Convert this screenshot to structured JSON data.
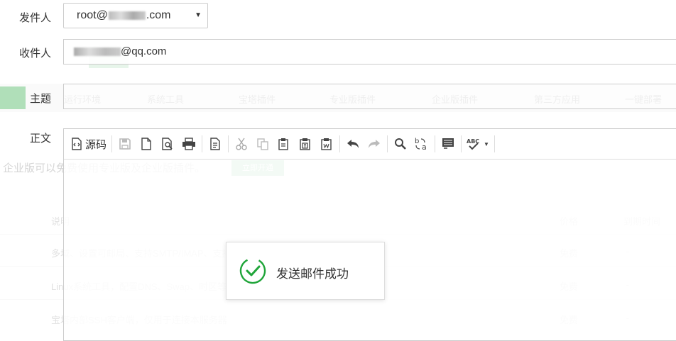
{
  "form": {
    "sender_label": "发件人",
    "sender_prefix": "root@",
    "sender_suffix": ".com",
    "recipient_label": "收件人",
    "recipient_suffix": "@qq.com",
    "subject_label": "主题",
    "body_label": "正文"
  },
  "toolbar": {
    "source_label": "源码",
    "items": [
      "source-icon",
      "save-icon",
      "new-page-icon",
      "preview-icon",
      "print-icon",
      "templates-icon",
      "cut-icon",
      "copy-icon",
      "paste-icon",
      "paste-text-icon",
      "paste-word-icon",
      "undo-icon",
      "redo-icon",
      "find-icon",
      "replace-icon",
      "select-all-icon",
      "spellcheck-icon"
    ]
  },
  "toast": {
    "message": "发送邮件成功",
    "icon": "success-check-icon",
    "color": "#20a53a"
  },
  "background": {
    "tabs": [
      "运行环境",
      "系统工具",
      "宝塔插件",
      "专业版插件",
      "企业版插件",
      "第三方应用",
      "一键部署"
    ],
    "notice": "企业版可以免费使用专业版及企业版插件。",
    "notice_button": "立即开通",
    "col_desc": "说明",
    "col_price": "价格",
    "col_expire": "到期时间",
    "rows": [
      {
        "desc": "多域、设置可邮局、支持SMTP/IMAP、支持发送外部邮件",
        "price": "免费",
        "expire": "-"
      },
      {
        "desc": "Linux系统工具，配置DNS、Swap、时区等",
        "price": "免费",
        "expire": "-"
      },
      {
        "desc": "宝塔内部SSH客户端，仅用于连接本服务器",
        "price": "免费",
        "expire": "-"
      }
    ]
  }
}
